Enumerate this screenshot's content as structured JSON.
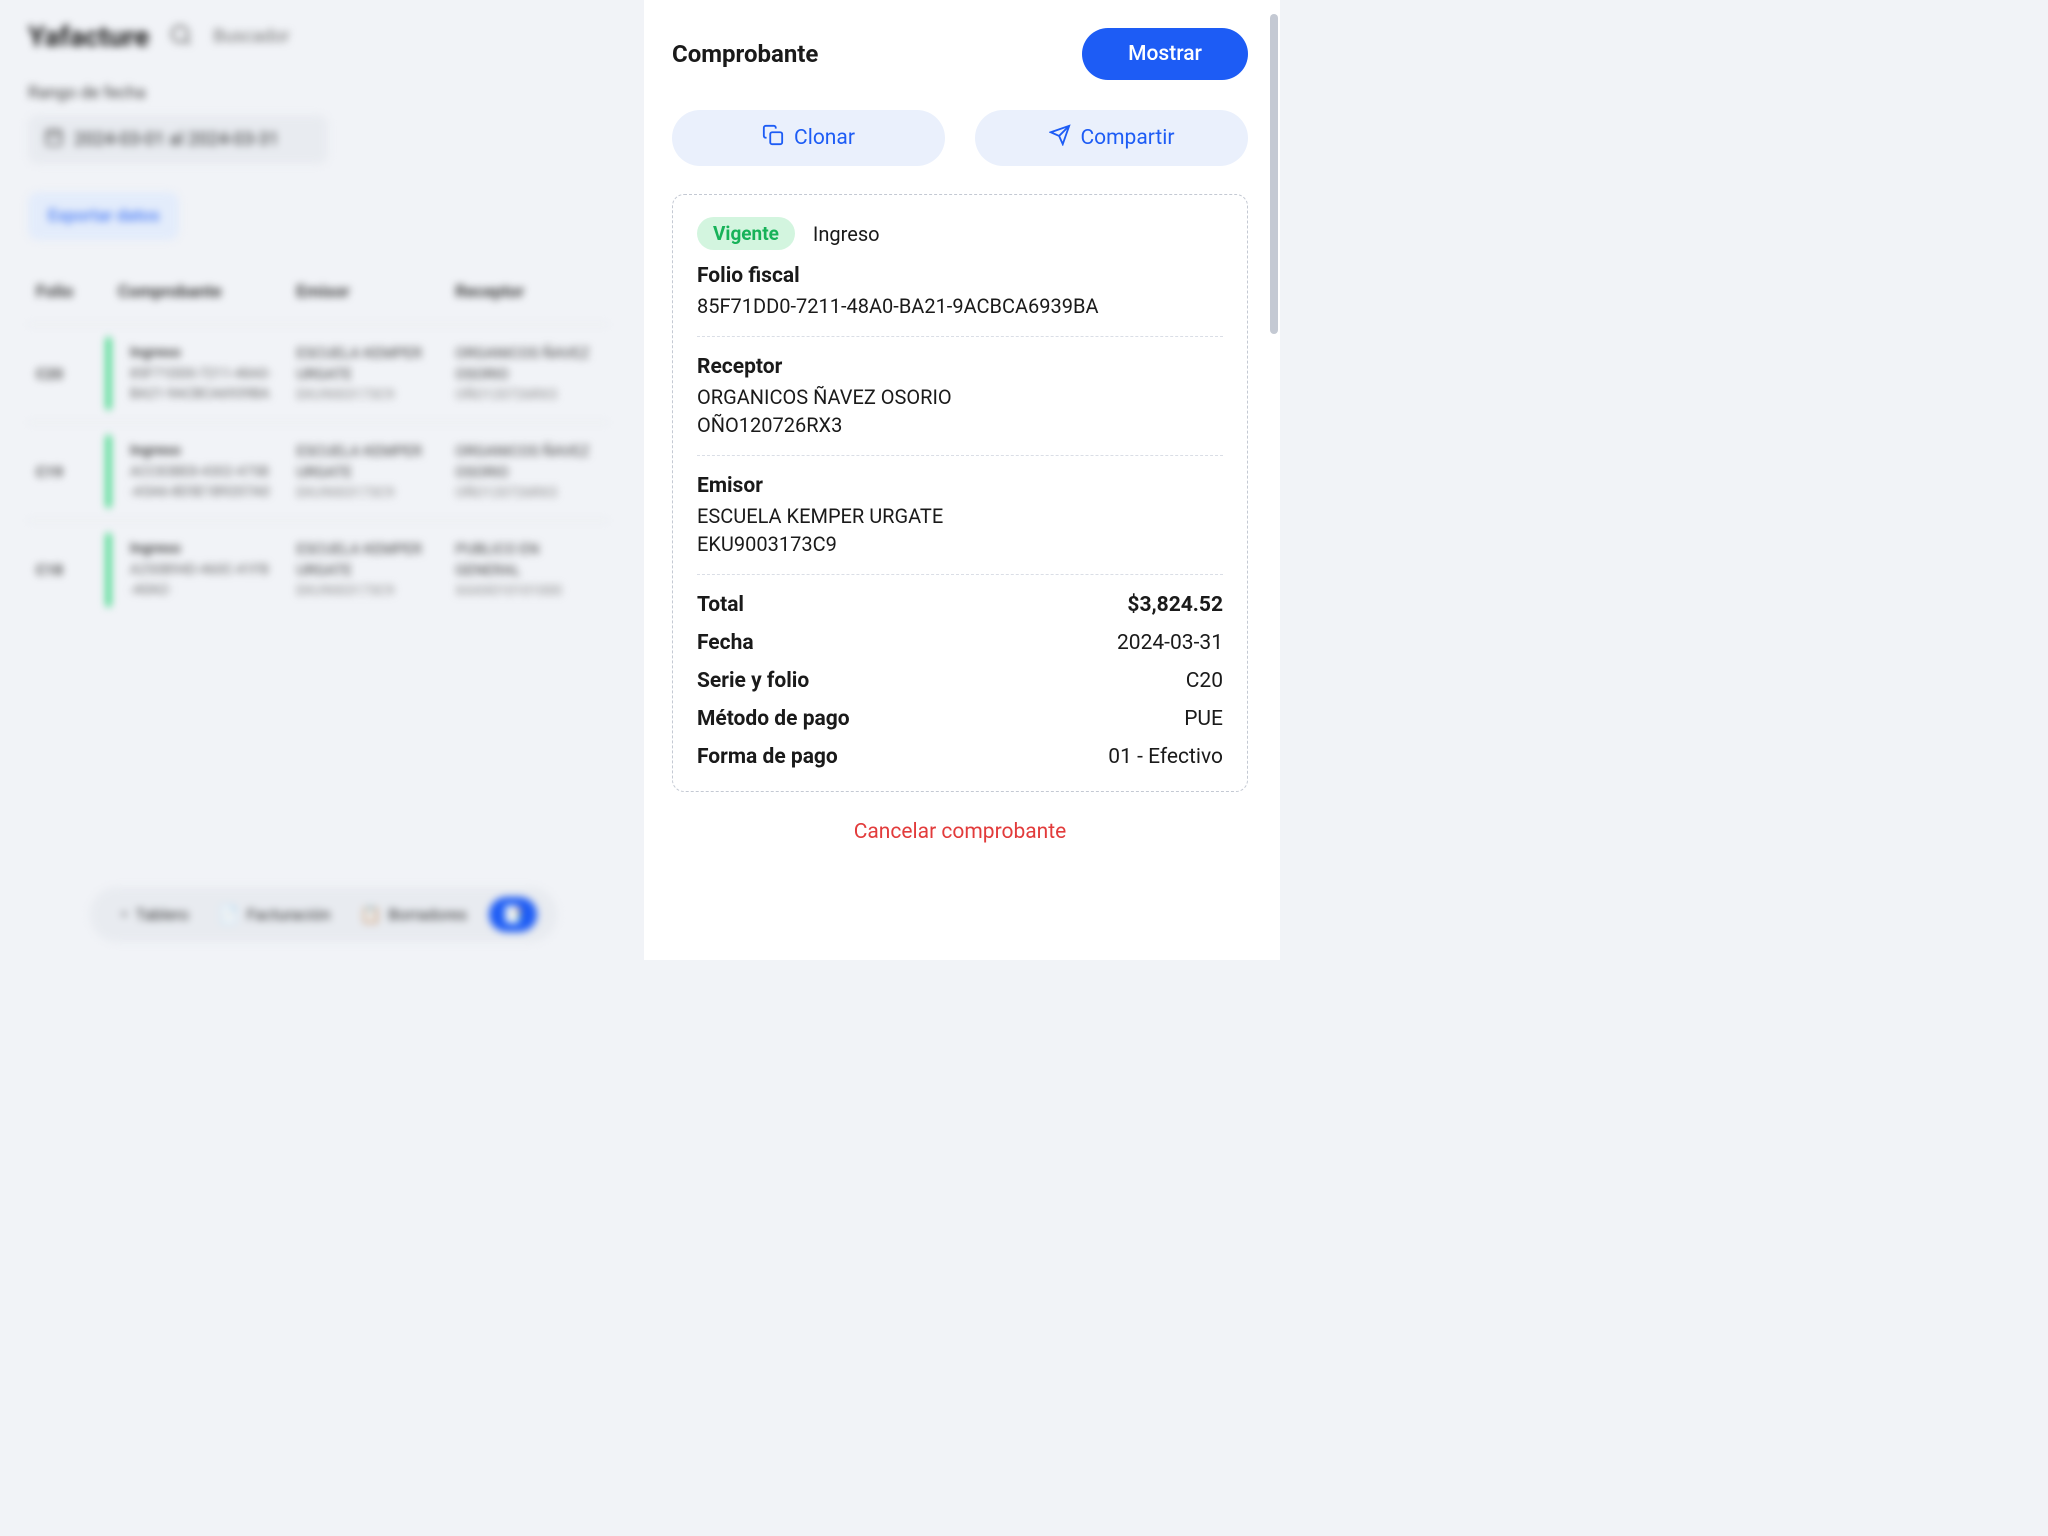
{
  "background": {
    "logo": "Yafacture",
    "search_placeholder": "Buscador",
    "date_range_label": "Rango de fecha",
    "date_range_value": "2024-03-01 al 2024-03-31",
    "export_label": "Exportar datos",
    "columns": {
      "folio": "Folio",
      "comprobante": "Comprobante",
      "emisor": "Emisor",
      "receptor": "Receptor"
    },
    "rows": [
      {
        "folio": "C20",
        "type": "Ingreso",
        "uuid": "85F71DD0-7211-48A0-BA21-9ACBCA6939BA",
        "emisor_name": "ESCUELA KEMPER URGATE",
        "emisor_rfc": "EKU9003173C9",
        "receptor_name": "ORGANICOS ÑAVEZ OSORIO",
        "receptor_rfc": "OÑO120726RX3"
      },
      {
        "folio": "C19",
        "type": "Ingreso",
        "uuid": "ACC83BE8-4302-475B-A5A6-8D5E1B9207A0",
        "emisor_name": "ESCUELA KEMPER URGATE",
        "emisor_rfc": "EKU9003173C9",
        "receptor_name": "ORGANICOS ÑAVEZ OSORIO",
        "receptor_rfc": "OÑO120726RX3"
      },
      {
        "folio": "C18",
        "type": "Ingreso",
        "uuid": "A250B94D-460C-41FB-A0A2-",
        "emisor_name": "ESCUELA KEMPER URGATE",
        "emisor_rfc": "EKU9003173C9",
        "receptor_name": "PUBLICO EN GENERAL",
        "receptor_rfc": "XAXX010101000"
      }
    ],
    "tabs": {
      "tablero": "Tablero",
      "facturacion": "Facturación",
      "borradores": "Borradores"
    }
  },
  "panel": {
    "title": "Comprobante",
    "show_label": "Mostrar",
    "clone_label": "Clonar",
    "share_label": "Compartir",
    "status": "Vigente",
    "doc_type": "Ingreso",
    "folio_fiscal_label": "Folio fiscal",
    "folio_fiscal_value": "85F71DD0-7211-48A0-BA21-9ACBCA6939BA",
    "receptor_label": "Receptor",
    "receptor_name": "ORGANICOS ÑAVEZ OSORIO",
    "receptor_rfc": "OÑO120726RX3",
    "emisor_label": "Emisor",
    "emisor_name": "ESCUELA KEMPER URGATE",
    "emisor_rfc": "EKU9003173C9",
    "total_label": "Total",
    "total_value": "$3,824.52",
    "fecha_label": "Fecha",
    "fecha_value": "2024-03-31",
    "serie_label": "Serie y folio",
    "serie_value": "C20",
    "metodo_pago_label": "Método de pago",
    "metodo_pago_value": "PUE",
    "forma_pago_label": "Forma de pago",
    "forma_pago_value": "01 - Efectivo",
    "cancel_label": "Cancelar comprobante"
  }
}
